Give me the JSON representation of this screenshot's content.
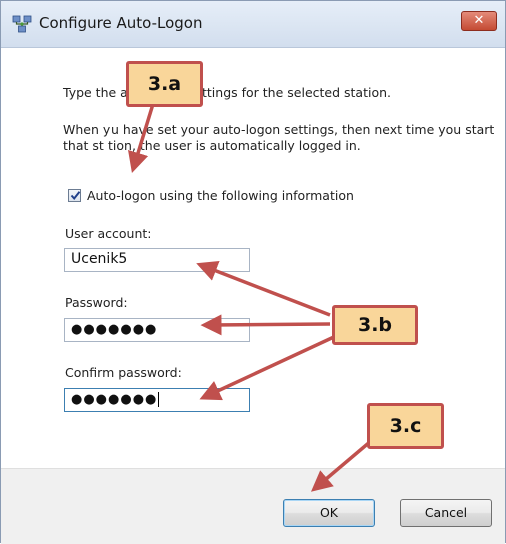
{
  "window": {
    "title": "Configure Auto-Logon",
    "close_label": "✕"
  },
  "content": {
    "intro_line_prefix": "Type the a",
    "intro_line_suffix": "ttings for the selected station.",
    "info_line_1": "When y",
    "info_line_1_rest": "u have set your auto-logon settings, then next time you start",
    "info_line_2_prefix": "that st",
    "info_line_2_rest": "tion, the user is automatically logged in.",
    "auto_logon_checkbox_label": "Auto-logon using the following information",
    "auto_logon_checked": true,
    "user_account_label": "User account:",
    "user_account_value": "Ucenik5",
    "password_label": "Password:",
    "password_value": "●●●●●●●",
    "confirm_password_label": "Confirm password:",
    "confirm_password_value": "●●●●●●●"
  },
  "buttons": {
    "ok_label": "OK",
    "cancel_label": "Cancel"
  },
  "annotations": {
    "callout_a": "3.a",
    "callout_b": "3.b",
    "callout_c": "3.c"
  },
  "colors": {
    "arrow": "#c0504d",
    "callout_fill": "#f9d69a"
  }
}
